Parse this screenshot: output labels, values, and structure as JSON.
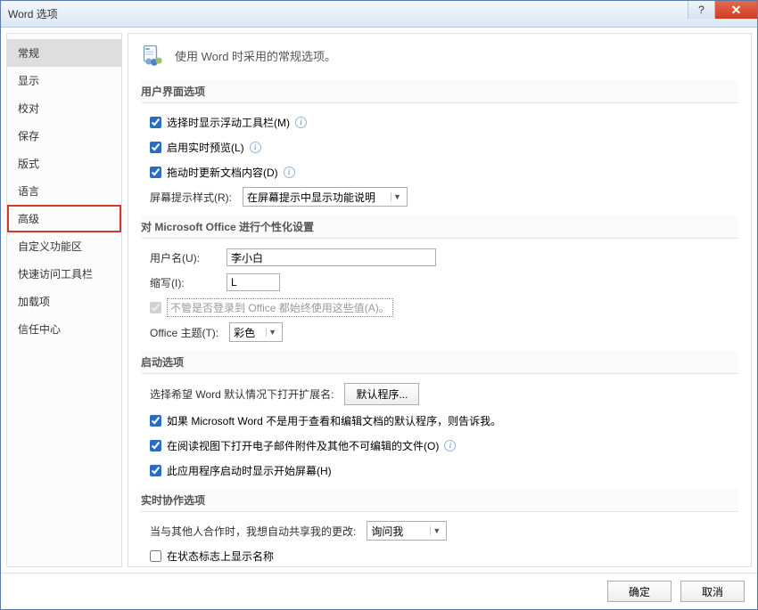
{
  "window": {
    "title": "Word 选项"
  },
  "sidebar": {
    "items": [
      {
        "label": "常规",
        "selected": true
      },
      {
        "label": "显示"
      },
      {
        "label": "校对"
      },
      {
        "label": "保存"
      },
      {
        "label": "版式"
      },
      {
        "label": "语言"
      },
      {
        "label": "高级",
        "boxed": true
      },
      {
        "label": "自定义功能区"
      },
      {
        "label": "快速访问工具栏"
      },
      {
        "label": "加载项"
      },
      {
        "label": "信任中心"
      }
    ]
  },
  "header": {
    "text": "使用 Word 时采用的常规选项。"
  },
  "sections": {
    "ui": {
      "title": "用户界面选项",
      "opt_mini_toolbar": "选择时显示浮动工具栏(M)",
      "opt_live_preview": "启用实时预览(L)",
      "opt_update_drag": "拖动时更新文档内容(D)",
      "screentip_label": "屏幕提示样式(R):",
      "screentip_value": "在屏幕提示中显示功能说明"
    },
    "personalize": {
      "title": "对 Microsoft Office 进行个性化设置",
      "username_label": "用户名(U):",
      "username_value": "李小白",
      "initials_label": "缩写(I):",
      "initials_value": "L",
      "always_use": "不管是否登录到 Office 都始终使用这些值(A)。",
      "theme_label": "Office 主题(T):",
      "theme_value": "彩色"
    },
    "startup": {
      "title": "启动选项",
      "ext_label": "选择希望 Word 默认情况下打开扩展名:",
      "ext_button": "默认程序...",
      "opt_default_prog": "如果 Microsoft Word 不是用于查看和编辑文档的默认程序，则告诉我。",
      "opt_reading_view": "在阅读视图下打开电子邮件附件及其他不可编辑的文件(O)",
      "opt_start_screen": "此应用程序启动时显示开始屏幕(H)"
    },
    "collab": {
      "title": "实时协作选项",
      "share_label": "当与其他人合作时，我想自动共享我的更改:",
      "share_value": "询问我",
      "show_names": "在状态标志上显示名称"
    }
  },
  "footer": {
    "ok": "确定",
    "cancel": "取消"
  }
}
